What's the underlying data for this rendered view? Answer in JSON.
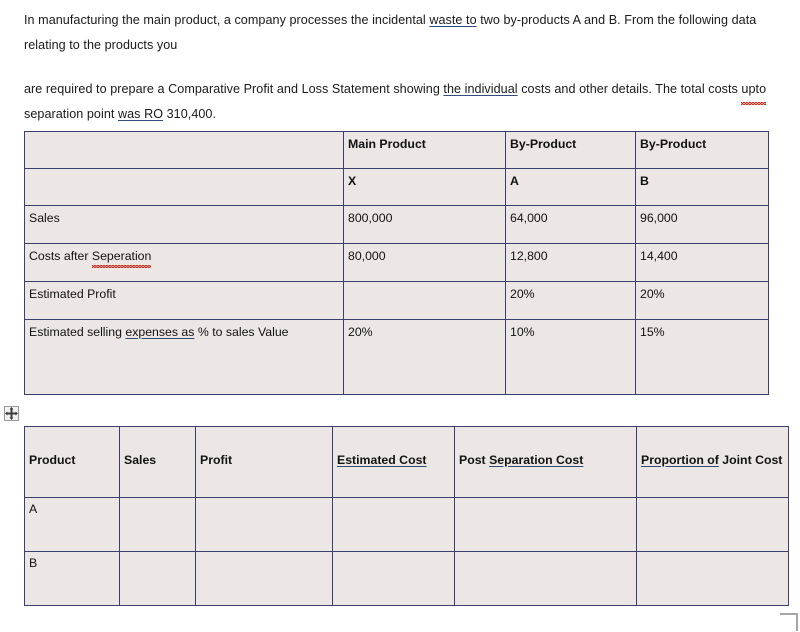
{
  "document": {
    "paragraph_1": {
      "seg_1": "In manufacturing the main product, a company processes the incidental ",
      "underlined_1": "waste  to",
      "seg_2": " two by-products A and B. From the following data relating to the products you"
    },
    "paragraph_2": {
      "seg_1": "are required to prepare a Comparative Profit and Loss Statement showing ",
      "underlined_1": "the  individual",
      "seg_2": " costs and other details. The total costs ",
      "misspelled_1": "upto",
      "seg_3": " separation point ",
      "underlined_2": "was  RO",
      "seg_4": " 310,400."
    }
  },
  "table_one": {
    "columns": [
      "",
      "Main Product",
      "By-Product",
      "By-Product"
    ],
    "subheader": [
      "",
      "X",
      "A",
      "B"
    ],
    "rows": [
      {
        "label": "Sales",
        "label_misspelled": "",
        "x": "800,000",
        "a": "64,000",
        "b": "96,000"
      },
      {
        "label": "Costs after ",
        "label_misspelled": "Seperation",
        "x": "80,000",
        "a": "12,800",
        "b": "14,400"
      },
      {
        "label": "Estimated Profit",
        "label_misspelled": "",
        "x": "",
        "a": "20%",
        "b": "20%"
      }
    ],
    "last_row": {
      "label_seg_1": "Estimated selling ",
      "label_underlined": "expenses  as",
      "label_seg_2": " % to sales Value",
      "x": "20%",
      "a": "10%",
      "b": "15%"
    }
  },
  "table_two": {
    "headers": {
      "product": "Product",
      "sales": "Sales",
      "profit": "Profit",
      "estimated_cost": "Estimated  Cost",
      "post_separation_prefix": "Post ",
      "post_separation_underlined": "Separation  Cost",
      "proportion_underlined": "Proportion  of",
      "proportion_rest": " Joint Cost"
    },
    "rows": [
      {
        "product": "A",
        "sales": "",
        "profit": "",
        "estimated_cost": "",
        "post_separation_cost": "",
        "proportion_joint_cost": ""
      },
      {
        "product": "B",
        "sales": "",
        "profit": "",
        "estimated_cost": "",
        "post_separation_cost": "",
        "proportion_joint_cost": ""
      }
    ]
  },
  "controls": {
    "move_handle": "table-move-handle",
    "resize_handle": "table-resize-handle"
  },
  "colors": {
    "cell_background": "#ece6e4",
    "cell_border": "#3a3f6b",
    "spellcheck_underline": "#c0392b",
    "link_underline": "#2f4f7a"
  }
}
